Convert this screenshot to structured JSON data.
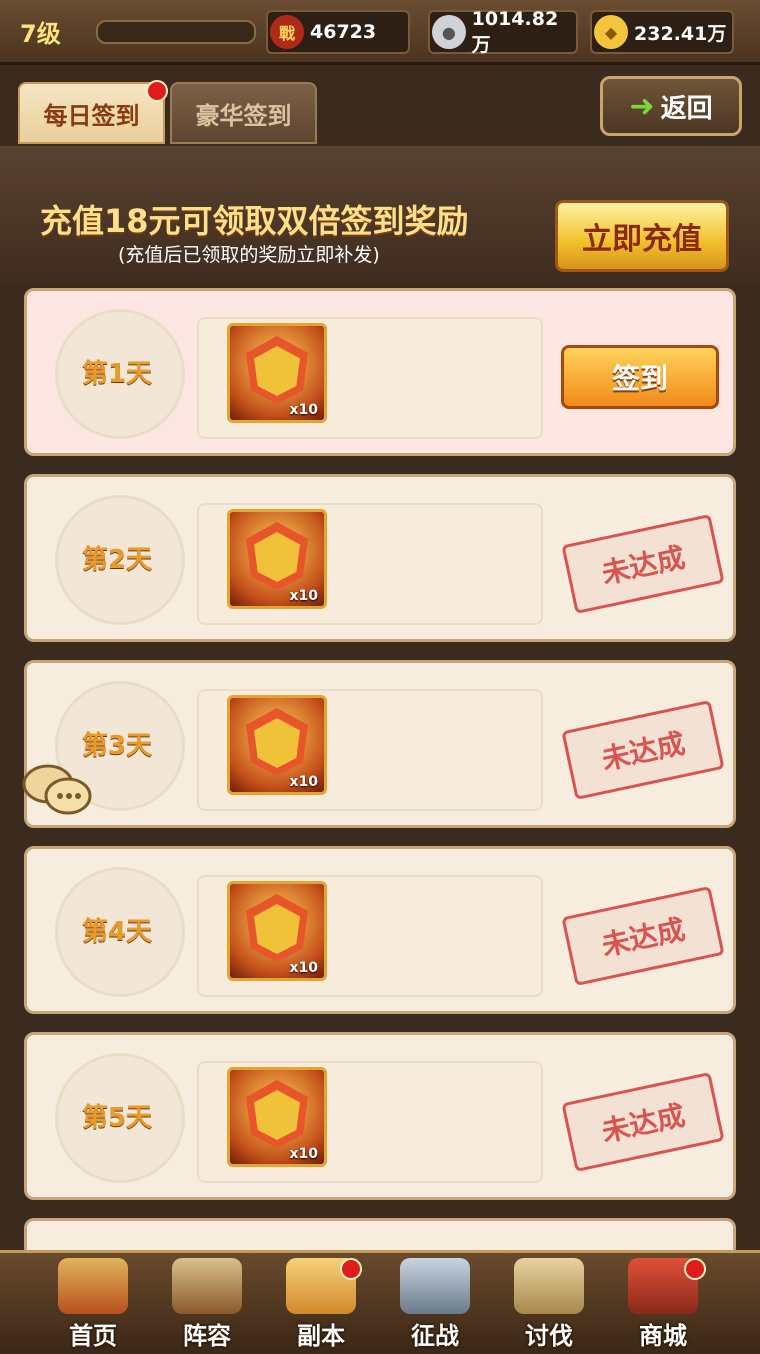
{
  "topbar": {
    "level": "7级",
    "power_icon": "zhan-icon",
    "power": "46723",
    "silver_icon": "silver-coin-icon",
    "silver": "1014.82万",
    "gold_icon": "gold-ingot-icon",
    "gold": "232.41万"
  },
  "tabs": [
    {
      "label": "每日签到",
      "active": true,
      "badge": true
    },
    {
      "label": "豪华签到",
      "active": false,
      "badge": false
    }
  ],
  "back_label": "返回",
  "banner": {
    "main": "充值18元可领取双倍签到奖励",
    "sub": "(充值后已领取的奖励立即补发)",
    "recharge_label": "立即充值"
  },
  "days": [
    {
      "label": "第1天",
      "item_qty": "x10",
      "status": "签到",
      "claimable": true
    },
    {
      "label": "第2天",
      "item_qty": "x10",
      "status": "未达成",
      "claimable": false
    },
    {
      "label": "第3天",
      "item_qty": "x10",
      "status": "未达成",
      "claimable": false
    },
    {
      "label": "第4天",
      "item_qty": "x10",
      "status": "未达成",
      "claimable": false
    },
    {
      "label": "第5天",
      "item_qty": "x10",
      "status": "未达成",
      "claimable": false
    }
  ],
  "bottom_nav": [
    {
      "label": "首页",
      "icon": "palace-icon",
      "badge": false
    },
    {
      "label": "阵容",
      "icon": "helmet-icon",
      "badge": false
    },
    {
      "label": "副本",
      "icon": "scroll-icon",
      "badge": true
    },
    {
      "label": "征战",
      "icon": "crossed-swords-icon",
      "badge": false
    },
    {
      "label": "讨伐",
      "icon": "mountain-icon",
      "badge": false
    },
    {
      "label": "商城",
      "icon": "shop-icon",
      "badge": true
    }
  ],
  "colors": {
    "accent": "#e99a2a",
    "stamp": "#d9534f",
    "badge": "#e01b1b"
  }
}
